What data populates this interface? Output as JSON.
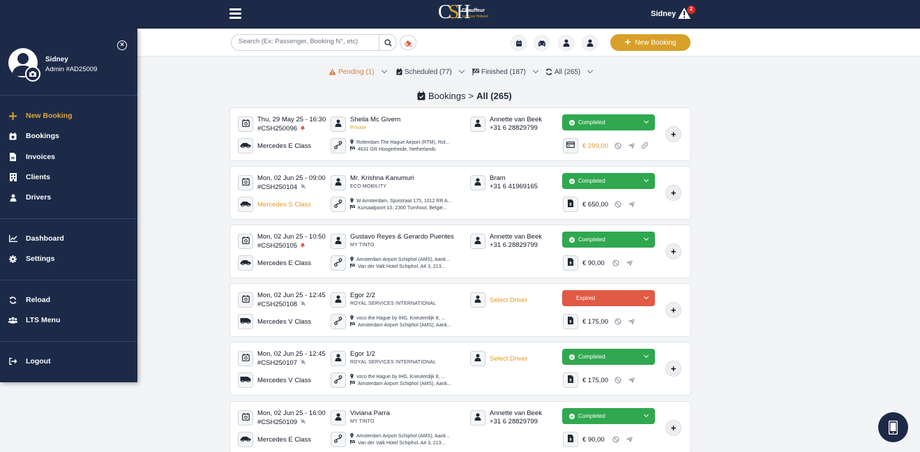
{
  "topbar": {
    "logo_text_top": "Chauffeur",
    "logo_text_bottom": "Services Holland",
    "user_name": "Sidney",
    "alert_count": "2"
  },
  "toolbar": {
    "search_placeholder": "Search (Ex: Passenger, Booking N°, etc)",
    "new_booking_label": "New Booking"
  },
  "filters": {
    "pending": "Pending (1)",
    "scheduled": "Scheduled (77)",
    "finished": "Finished (187)",
    "all": "All (265)"
  },
  "heading": {
    "label": "Bookings",
    "sep": ">",
    "current": "All (265)"
  },
  "bookings": [
    {
      "datetime": "Thu, 29 May 25 - 16:30",
      "ref": "#CSH250096",
      "ref_icon": "bell-icon",
      "vehicle": "Mercedes E Class",
      "vehicle_highlight": false,
      "passenger": "Sheila Mc Givern",
      "company": "Private",
      "company_highlight": true,
      "pickup": "Rotterdam The Hague Airport (RTM), Rot...",
      "dropoff": "4631 GR Hoogerheide, Netherlands",
      "driver": "Annette van Beek",
      "driver_phone": "+31 6 28829799",
      "status": "Completed",
      "payment_icon": "credit-card-icon",
      "price": "€ 299,00",
      "price_highlight": true,
      "has_link": true
    },
    {
      "datetime": "Mon, 02 Jun 25 - 09:00",
      "ref": "#CSH250104",
      "ref_icon": "bell-slash-icon",
      "vehicle": "Mercedes S Class",
      "vehicle_highlight": true,
      "passenger": "Mr. Krishna Kanumuri",
      "company": "ECO MOBILITY",
      "company_highlight": false,
      "pickup": "W Amsterdam, Spuistraat 175, 1012 RR A...",
      "dropoff": "Kursaalpoort 10, 2300 Turnhout, België...",
      "driver": "Bram",
      "driver_phone": "+31 6 41969165",
      "status": "Completed",
      "payment_icon": "invoice-icon",
      "price": "€ 650,00",
      "price_highlight": false,
      "has_link": false
    },
    {
      "datetime": "Mon, 02 Jun 25 - 10:50",
      "ref": "#CSH250105",
      "ref_icon": "bell-icon",
      "vehicle": "Mercedes E Class",
      "vehicle_highlight": false,
      "passenger": "Gustavo Reyes & Gerardo Puentes",
      "company": "MY TINTO",
      "company_highlight": false,
      "pickup": "Amsterdam Airport Schiphol (AMS), Aank...",
      "dropoff": "Van der Valk Hotel Schiphol, A4 3, 213...",
      "driver": "Annette van Beek",
      "driver_phone": "+31 6 28829799",
      "status": "Completed",
      "payment_icon": "invoice-icon",
      "price": "€ 90,00",
      "price_highlight": false,
      "has_link": false
    },
    {
      "datetime": "Mon, 02 Jun 25 - 12:45",
      "ref": "#CSH250108",
      "ref_icon": "bell-slash-icon",
      "vehicle": "Mercedes V Class",
      "vehicle_highlight": false,
      "passenger": "Egor 2/2",
      "company": "ROYAL SERVICES INTERNATIONAL",
      "company_highlight": false,
      "pickup": "voco the Hague by IHG, Kneuterdijk 8, ...",
      "dropoff": "Amsterdam Airport Schiphol (AMS), Aank...",
      "driver": "Select Driver",
      "driver_phone": "",
      "status": "Expired",
      "payment_icon": "invoice-icon",
      "price": "€ 175,00",
      "price_highlight": false,
      "has_link": false
    },
    {
      "datetime": "Mon, 02 Jun 25 - 12:45",
      "ref": "#CSH250107",
      "ref_icon": "bell-slash-icon",
      "vehicle": "Mercedes V Class",
      "vehicle_highlight": false,
      "passenger": "Egor 1/2",
      "company": "ROYAL SERVICES INTERNATIONAL",
      "company_highlight": false,
      "pickup": "voco the Hague by IHG, Kneuterdijk 8, ...",
      "dropoff": "Amsterdam Airport Schiphol (AMS), Aank...",
      "driver": "Select Driver",
      "driver_phone": "",
      "status": "Completed",
      "payment_icon": "invoice-icon",
      "price": "€ 175,00",
      "price_highlight": false,
      "has_link": false
    },
    {
      "datetime": "Mon, 02 Jun 25 - 16:00",
      "ref": "#CSH250109",
      "ref_icon": "bell-slash-icon",
      "vehicle": "Mercedes E Class",
      "vehicle_highlight": false,
      "passenger": "Viviana Parra",
      "company": "MY TINTO",
      "company_highlight": false,
      "pickup": "Amsterdam Airport Schiphol (AMS), Aank...",
      "dropoff": "Van der Valk Hotel Schiphol, A4 3, 213...",
      "driver": "Annette van Beek",
      "driver_phone": "+31 6 28829799",
      "status": "Completed",
      "payment_icon": "invoice-icon",
      "price": "€ 90,00",
      "price_highlight": false,
      "has_link": false
    }
  ],
  "sidebar": {
    "user_name": "Sidney",
    "user_role": "Admin #AD25009",
    "items": [
      {
        "label": "New Booking",
        "icon": "plus-icon",
        "active": true
      },
      {
        "label": "Bookings",
        "icon": "calendar-icon",
        "active": false
      },
      {
        "label": "Invoices",
        "icon": "file-icon",
        "active": false
      },
      {
        "label": "Clients",
        "icon": "building-icon",
        "active": false
      },
      {
        "label": "Drivers",
        "icon": "user-icon",
        "active": false
      },
      {
        "label": "Dashboard",
        "icon": "chart-icon",
        "active": false
      },
      {
        "label": "Settings",
        "icon": "gear-icon",
        "active": false
      },
      {
        "label": "Reload",
        "icon": "refresh-icon",
        "active": false
      },
      {
        "label": "LTS Menu",
        "icon": "users-icon",
        "active": false
      },
      {
        "label": "Logout",
        "icon": "logout-icon",
        "active": false
      }
    ]
  },
  "colors": {
    "navy": "#1c2a48",
    "gold": "#d8a02a",
    "completed": "#2fa84f",
    "expired": "#e05a44",
    "pending": "#e07a3c"
  }
}
